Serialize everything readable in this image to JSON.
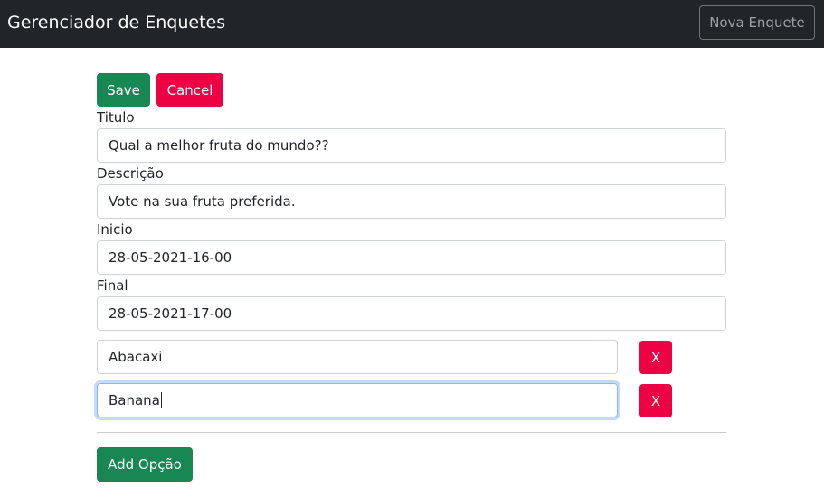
{
  "app": {
    "title": "Gerenciador de Enquetes",
    "new_poll_label": "Nova Enquete"
  },
  "toolbar": {
    "save_label": "Save",
    "cancel_label": "Cancel"
  },
  "form": {
    "title_label": "Titulo",
    "title_value": "Qual a melhor fruta do mundo??",
    "description_label": "Descrição",
    "description_value": "Vote na sua fruta preferida.",
    "start_label": "Inicio",
    "start_value": "28-05-2021-16-00",
    "end_label": "Final",
    "end_value": "28-05-2021-17-00"
  },
  "options": [
    {
      "value": "Abacaxi",
      "remove_label": "X"
    },
    {
      "value": "Banana",
      "remove_label": "X"
    }
  ],
  "add_option_label": "Add Opção",
  "colors": {
    "navbar": "#212529",
    "success": "#198754",
    "danger": "#ee0044",
    "focus_border": "#86b7fe"
  }
}
